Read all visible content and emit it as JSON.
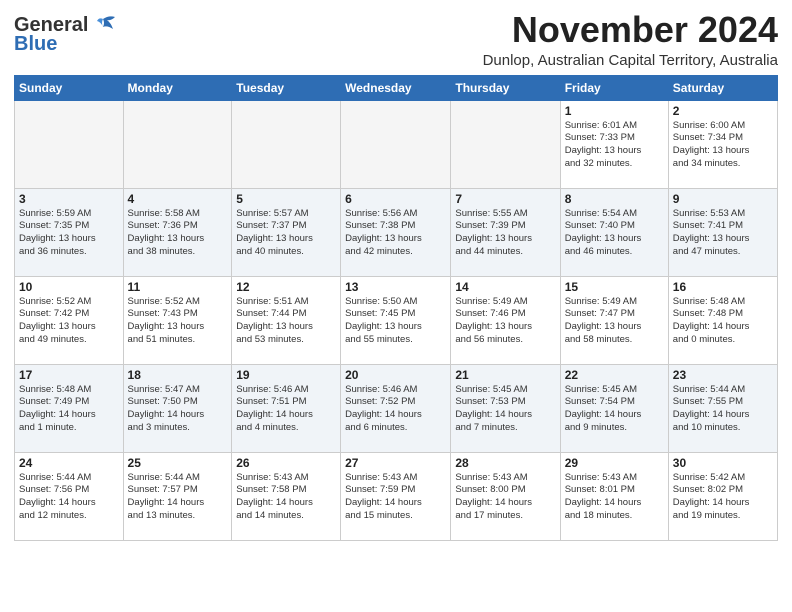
{
  "header": {
    "logo_general": "General",
    "logo_blue": "Blue",
    "month_title": "November 2024",
    "location": "Dunlop, Australian Capital Territory, Australia"
  },
  "days_of_week": [
    "Sunday",
    "Monday",
    "Tuesday",
    "Wednesday",
    "Thursday",
    "Friday",
    "Saturday"
  ],
  "weeks": [
    [
      {
        "day": "",
        "info": ""
      },
      {
        "day": "",
        "info": ""
      },
      {
        "day": "",
        "info": ""
      },
      {
        "day": "",
        "info": ""
      },
      {
        "day": "",
        "info": ""
      },
      {
        "day": "1",
        "info": "Sunrise: 6:01 AM\nSunset: 7:33 PM\nDaylight: 13 hours\nand 32 minutes."
      },
      {
        "day": "2",
        "info": "Sunrise: 6:00 AM\nSunset: 7:34 PM\nDaylight: 13 hours\nand 34 minutes."
      }
    ],
    [
      {
        "day": "3",
        "info": "Sunrise: 5:59 AM\nSunset: 7:35 PM\nDaylight: 13 hours\nand 36 minutes."
      },
      {
        "day": "4",
        "info": "Sunrise: 5:58 AM\nSunset: 7:36 PM\nDaylight: 13 hours\nand 38 minutes."
      },
      {
        "day": "5",
        "info": "Sunrise: 5:57 AM\nSunset: 7:37 PM\nDaylight: 13 hours\nand 40 minutes."
      },
      {
        "day": "6",
        "info": "Sunrise: 5:56 AM\nSunset: 7:38 PM\nDaylight: 13 hours\nand 42 minutes."
      },
      {
        "day": "7",
        "info": "Sunrise: 5:55 AM\nSunset: 7:39 PM\nDaylight: 13 hours\nand 44 minutes."
      },
      {
        "day": "8",
        "info": "Sunrise: 5:54 AM\nSunset: 7:40 PM\nDaylight: 13 hours\nand 46 minutes."
      },
      {
        "day": "9",
        "info": "Sunrise: 5:53 AM\nSunset: 7:41 PM\nDaylight: 13 hours\nand 47 minutes."
      }
    ],
    [
      {
        "day": "10",
        "info": "Sunrise: 5:52 AM\nSunset: 7:42 PM\nDaylight: 13 hours\nand 49 minutes."
      },
      {
        "day": "11",
        "info": "Sunrise: 5:52 AM\nSunset: 7:43 PM\nDaylight: 13 hours\nand 51 minutes."
      },
      {
        "day": "12",
        "info": "Sunrise: 5:51 AM\nSunset: 7:44 PM\nDaylight: 13 hours\nand 53 minutes."
      },
      {
        "day": "13",
        "info": "Sunrise: 5:50 AM\nSunset: 7:45 PM\nDaylight: 13 hours\nand 55 minutes."
      },
      {
        "day": "14",
        "info": "Sunrise: 5:49 AM\nSunset: 7:46 PM\nDaylight: 13 hours\nand 56 minutes."
      },
      {
        "day": "15",
        "info": "Sunrise: 5:49 AM\nSunset: 7:47 PM\nDaylight: 13 hours\nand 58 minutes."
      },
      {
        "day": "16",
        "info": "Sunrise: 5:48 AM\nSunset: 7:48 PM\nDaylight: 14 hours\nand 0 minutes."
      }
    ],
    [
      {
        "day": "17",
        "info": "Sunrise: 5:48 AM\nSunset: 7:49 PM\nDaylight: 14 hours\nand 1 minute."
      },
      {
        "day": "18",
        "info": "Sunrise: 5:47 AM\nSunset: 7:50 PM\nDaylight: 14 hours\nand 3 minutes."
      },
      {
        "day": "19",
        "info": "Sunrise: 5:46 AM\nSunset: 7:51 PM\nDaylight: 14 hours\nand 4 minutes."
      },
      {
        "day": "20",
        "info": "Sunrise: 5:46 AM\nSunset: 7:52 PM\nDaylight: 14 hours\nand 6 minutes."
      },
      {
        "day": "21",
        "info": "Sunrise: 5:45 AM\nSunset: 7:53 PM\nDaylight: 14 hours\nand 7 minutes."
      },
      {
        "day": "22",
        "info": "Sunrise: 5:45 AM\nSunset: 7:54 PM\nDaylight: 14 hours\nand 9 minutes."
      },
      {
        "day": "23",
        "info": "Sunrise: 5:44 AM\nSunset: 7:55 PM\nDaylight: 14 hours\nand 10 minutes."
      }
    ],
    [
      {
        "day": "24",
        "info": "Sunrise: 5:44 AM\nSunset: 7:56 PM\nDaylight: 14 hours\nand 12 minutes."
      },
      {
        "day": "25",
        "info": "Sunrise: 5:44 AM\nSunset: 7:57 PM\nDaylight: 14 hours\nand 13 minutes."
      },
      {
        "day": "26",
        "info": "Sunrise: 5:43 AM\nSunset: 7:58 PM\nDaylight: 14 hours\nand 14 minutes."
      },
      {
        "day": "27",
        "info": "Sunrise: 5:43 AM\nSunset: 7:59 PM\nDaylight: 14 hours\nand 15 minutes."
      },
      {
        "day": "28",
        "info": "Sunrise: 5:43 AM\nSunset: 8:00 PM\nDaylight: 14 hours\nand 17 minutes."
      },
      {
        "day": "29",
        "info": "Sunrise: 5:43 AM\nSunset: 8:01 PM\nDaylight: 14 hours\nand 18 minutes."
      },
      {
        "day": "30",
        "info": "Sunrise: 5:42 AM\nSunset: 8:02 PM\nDaylight: 14 hours\nand 19 minutes."
      }
    ]
  ]
}
